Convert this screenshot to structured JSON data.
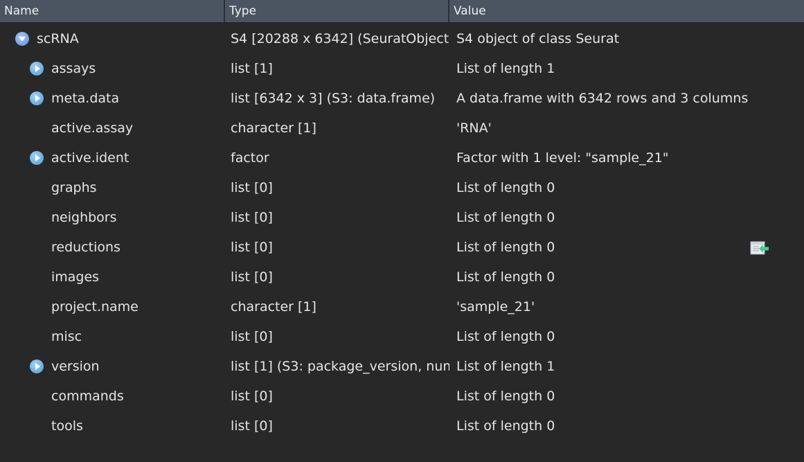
{
  "columns": {
    "name": "Name",
    "type": "Type",
    "value": "Value"
  },
  "root": {
    "name": "scRNA",
    "type": "S4 [20288 x 6342] (SeuratObject::",
    "value": "S4 object of class Seurat",
    "expanded": true
  },
  "children": [
    {
      "name": "assays",
      "type": "list [1]",
      "value": "List of length 1",
      "expandable": true
    },
    {
      "name": "meta.data",
      "type": "list [6342 x 3] (S3: data.frame)",
      "value": "A data.frame with 6342 rows and 3 columns",
      "expandable": true
    },
    {
      "name": "active.assay",
      "type": "character [1]",
      "value": "'RNA'",
      "expandable": false
    },
    {
      "name": "active.ident",
      "type": "factor",
      "value": "Factor with 1 level: \"sample_21\"",
      "expandable": true
    },
    {
      "name": "graphs",
      "type": "list [0]",
      "value": "List of length 0",
      "expandable": false
    },
    {
      "name": "neighbors",
      "type": "list [0]",
      "value": "List of length 0",
      "expandable": false
    },
    {
      "name": "reductions",
      "type": "list [0]",
      "value": "List of length 0",
      "expandable": false,
      "view_icon": "view-data-icon"
    },
    {
      "name": "images",
      "type": "list [0]",
      "value": "List of length 0",
      "expandable": false
    },
    {
      "name": "project.name",
      "type": "character [1]",
      "value": "'sample_21'",
      "expandable": false
    },
    {
      "name": "misc",
      "type": "list [0]",
      "value": "List of length 0",
      "expandable": false
    },
    {
      "name": "version",
      "type": "list [1] (S3: package_version, num",
      "value": "List of length 1",
      "expandable": true
    },
    {
      "name": "commands",
      "type": "list [0]",
      "value": "List of length 0",
      "expandable": false
    },
    {
      "name": "tools",
      "type": "list [0]",
      "value": "List of length 0",
      "expandable": false
    }
  ]
}
